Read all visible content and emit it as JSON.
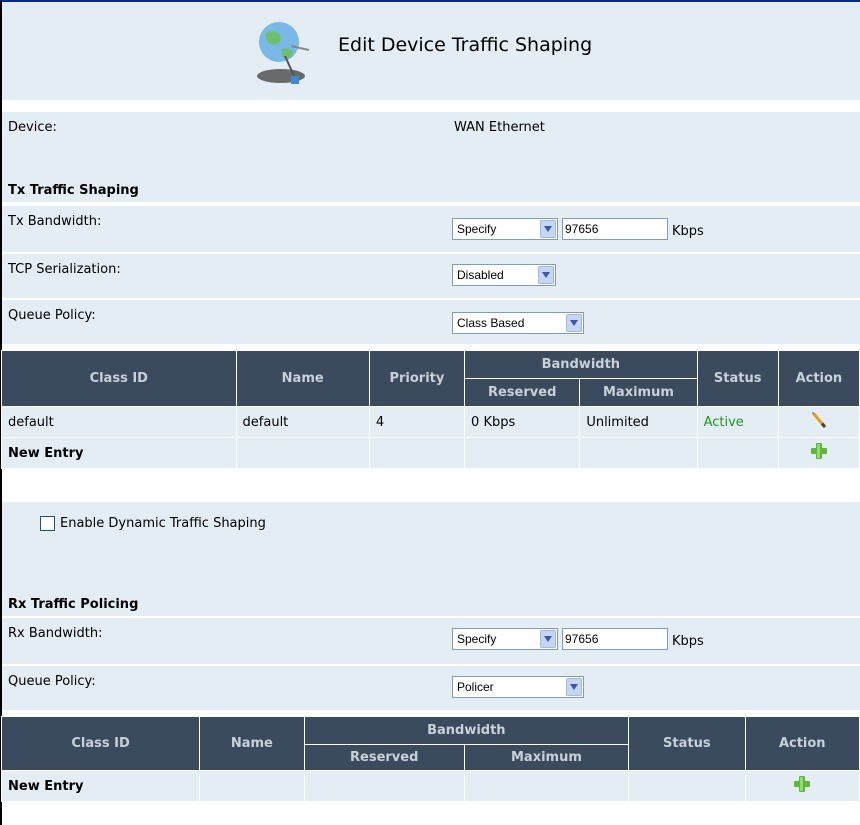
{
  "header": {
    "title": "Edit Device Traffic Shaping",
    "icon": "globe-network-icon"
  },
  "device": {
    "label": "Device:",
    "value": "WAN Ethernet"
  },
  "tx": {
    "section_title": "Tx Traffic Shaping",
    "bandwidth_label": "Tx Bandwidth:",
    "bandwidth_mode": "Specify",
    "bandwidth_value": "97656",
    "bandwidth_unit": "Kbps",
    "tcp_label": "TCP Serialization:",
    "tcp_value": "Disabled",
    "queue_label": "Queue Policy:",
    "queue_value": "Class Based",
    "table": {
      "headers": {
        "class_id": "Class ID",
        "name": "Name",
        "priority": "Priority",
        "bandwidth": "Bandwidth",
        "reserved": "Reserved",
        "maximum": "Maximum",
        "status": "Status",
        "action": "Action"
      },
      "rows": [
        {
          "class_id": "default",
          "name": "default",
          "priority": "4",
          "reserved": "0 Kbps",
          "maximum": "Unlimited",
          "status": "Active"
        }
      ],
      "new_entry": "New Entry"
    },
    "dynamic_label": "Enable Dynamic Traffic Shaping",
    "dynamic_checked": false
  },
  "rx": {
    "section_title": "Rx Traffic Policing",
    "bandwidth_label": "Rx Bandwidth:",
    "bandwidth_mode": "Specify",
    "bandwidth_value": "97656",
    "bandwidth_unit": "Kbps",
    "queue_label": "Queue Policy:",
    "queue_value": "Policer",
    "table": {
      "headers": {
        "class_id": "Class ID",
        "name": "Name",
        "bandwidth": "Bandwidth",
        "reserved": "Reserved",
        "maximum": "Maximum",
        "status": "Status",
        "action": "Action"
      },
      "new_entry": "New Entry"
    }
  },
  "colors": {
    "header_bg": "#3b4a5c",
    "row_bg": "#e4ecf4",
    "active": "#1a9a1a"
  }
}
